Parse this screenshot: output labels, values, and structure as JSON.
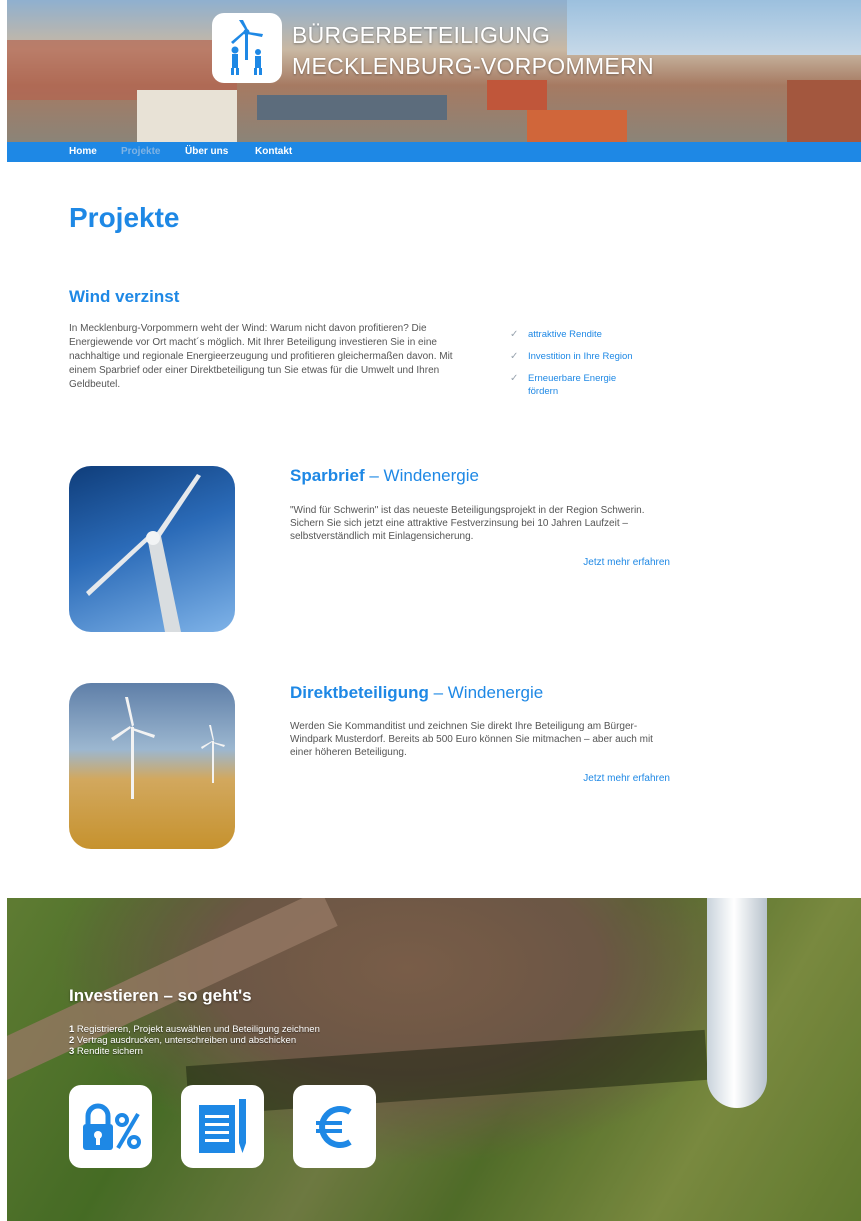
{
  "header": {
    "title_line1": "BÜRGERBETEILIGUNG",
    "title_line2": "MECKLENBURG-VORPOMMERN",
    "logo_icon": "wind-turbine-family-icon"
  },
  "nav": {
    "items": [
      {
        "label": "Home",
        "active": false
      },
      {
        "label": "Projekte",
        "active": true
      },
      {
        "label": "Über uns",
        "active": false
      },
      {
        "label": "Kontakt",
        "active": false
      }
    ]
  },
  "main": {
    "page_title": "Projekte",
    "section_title": "Wind verzinst",
    "intro_text": "In Mecklenburg-Vorpommern weht der Wind: Warum nicht davon profitieren? Die Energiewende vor Ort macht´s möglich. Mit Ihrer Beteiligung investieren Sie in eine nachhaltige und regionale Energieerzeugung und profitieren gleichermaßen davon. Mit einem Sparbrief oder einer Direktbeteiligung tun Sie etwas für die Umwelt und Ihren Geldbeutel.",
    "benefits": [
      "attraktive Rendite",
      "Investition in Ihre Region",
      "Erneuerbare Energie fördern"
    ],
    "cards": [
      {
        "title_bold": "Sparbrief",
        "title_rest": " – Windenergie",
        "text": "\"Wind für Schwerin\" ist das neueste Beteiligungsprojekt in der Region Schwerin. Sichern Sie sich jetzt eine attraktive Festverzinsung bei 10 Jahren Laufzeit – selbstverständlich mit Einlagensicherung.",
        "link": "Jetzt mehr erfahren"
      },
      {
        "title_bold": "Direktbeteiligung",
        "title_rest": " – Windenergie",
        "text": "Werden Sie Kommanditist und zeichnen Sie direkt Ihre Beteiligung am Bürger-Windpark Musterdorf. Bereits ab 500 Euro können Sie mitmachen – aber auch mit einer höheren Beteiligung.",
        "link": "Jetzt mehr erfahren"
      }
    ]
  },
  "invest": {
    "title": "Investieren – so geht's",
    "steps": [
      {
        "num": "1",
        "text": " Registrieren, Projekt auswählen und Beteiligung zeichnen"
      },
      {
        "num": "2",
        "text": " Vertrag ausdrucken, unterschreiben und abschicken"
      },
      {
        "num": "3",
        "text": " Rendite sichern"
      }
    ],
    "icons": [
      "percent-lock-icon",
      "contract-document-icon",
      "euro-icon"
    ]
  },
  "colors": {
    "accent": "#1e88e5",
    "nav_bg": "#1e88e5",
    "nav_active": "#7fb3e4"
  }
}
